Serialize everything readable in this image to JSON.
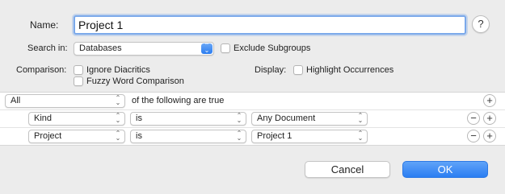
{
  "form": {
    "name_label": "Name:",
    "name_value": "Project 1",
    "help_label": "?",
    "search_in_label": "Search in:",
    "search_in_value": "Databases",
    "exclude_subgroups_label": "Exclude Subgroups",
    "comparison_label": "Comparison:",
    "ignore_diacritics_label": "Ignore Diacritics",
    "fuzzy_word_label": "Fuzzy Word Comparison",
    "display_label": "Display:",
    "highlight_label": "Highlight Occurrences"
  },
  "criteria": {
    "match_value": "All",
    "match_suffix": "of the following are true",
    "rows": [
      {
        "field": "Kind",
        "operator": "is",
        "value": "Any Document"
      },
      {
        "field": "Project",
        "operator": "is",
        "value": "Project 1"
      }
    ],
    "add_symbol": "+",
    "remove_symbol": "−"
  },
  "buttons": {
    "cancel": "Cancel",
    "ok": "OK"
  },
  "colors": {
    "accent": "#2b7ef2",
    "background": "#ececec"
  },
  "icons": {
    "popup_arrows": "up-down-chevron-icon",
    "help": "question-mark-icon"
  }
}
